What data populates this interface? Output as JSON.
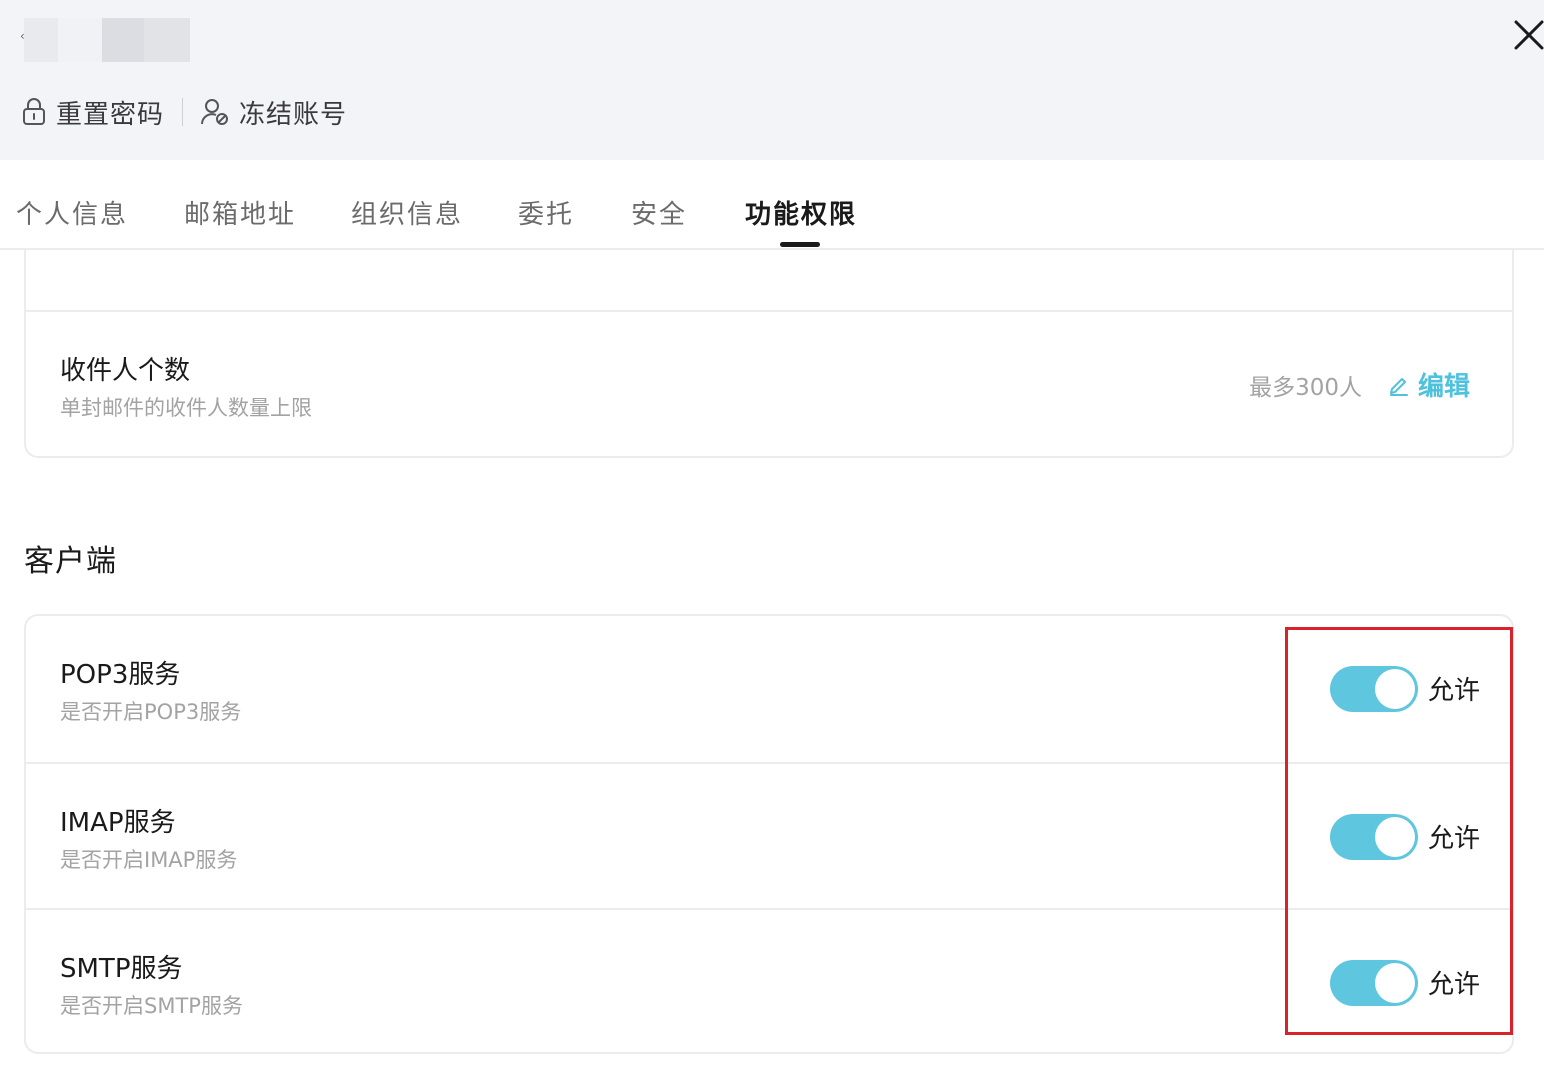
{
  "header": {
    "actions": [
      {
        "label": "重置密码",
        "icon": "lock-icon"
      },
      {
        "label": "冻结账号",
        "icon": "user-freeze-icon"
      }
    ],
    "close_icon": "close-icon"
  },
  "tabs": [
    {
      "label": "个人信息"
    },
    {
      "label": "邮箱地址"
    },
    {
      "label": "组织信息"
    },
    {
      "label": "委托"
    },
    {
      "label": "安全"
    },
    {
      "label": "功能权限"
    }
  ],
  "active_tab": "功能权限",
  "recipient_limit": {
    "title": "收件人个数",
    "description": "单封邮件的收件人数量上限",
    "value": "最多300人",
    "edit_label": "编辑"
  },
  "client_section": {
    "title": "客户端",
    "rows": [
      {
        "title": "POP3服务",
        "description": "是否开启POP3服务",
        "status": "允许",
        "enabled": true
      },
      {
        "title": "IMAP服务",
        "description": "是否开启IMAP服务",
        "status": "允许",
        "enabled": true
      },
      {
        "title": "SMTP服务",
        "description": "是否开启SMTP服务",
        "status": "允许",
        "enabled": true
      }
    ]
  },
  "colors": {
    "accent": "#5ec6de",
    "link": "#4ec1dd",
    "highlight": "#d8232a",
    "header_bg": "#f3f4f8"
  }
}
